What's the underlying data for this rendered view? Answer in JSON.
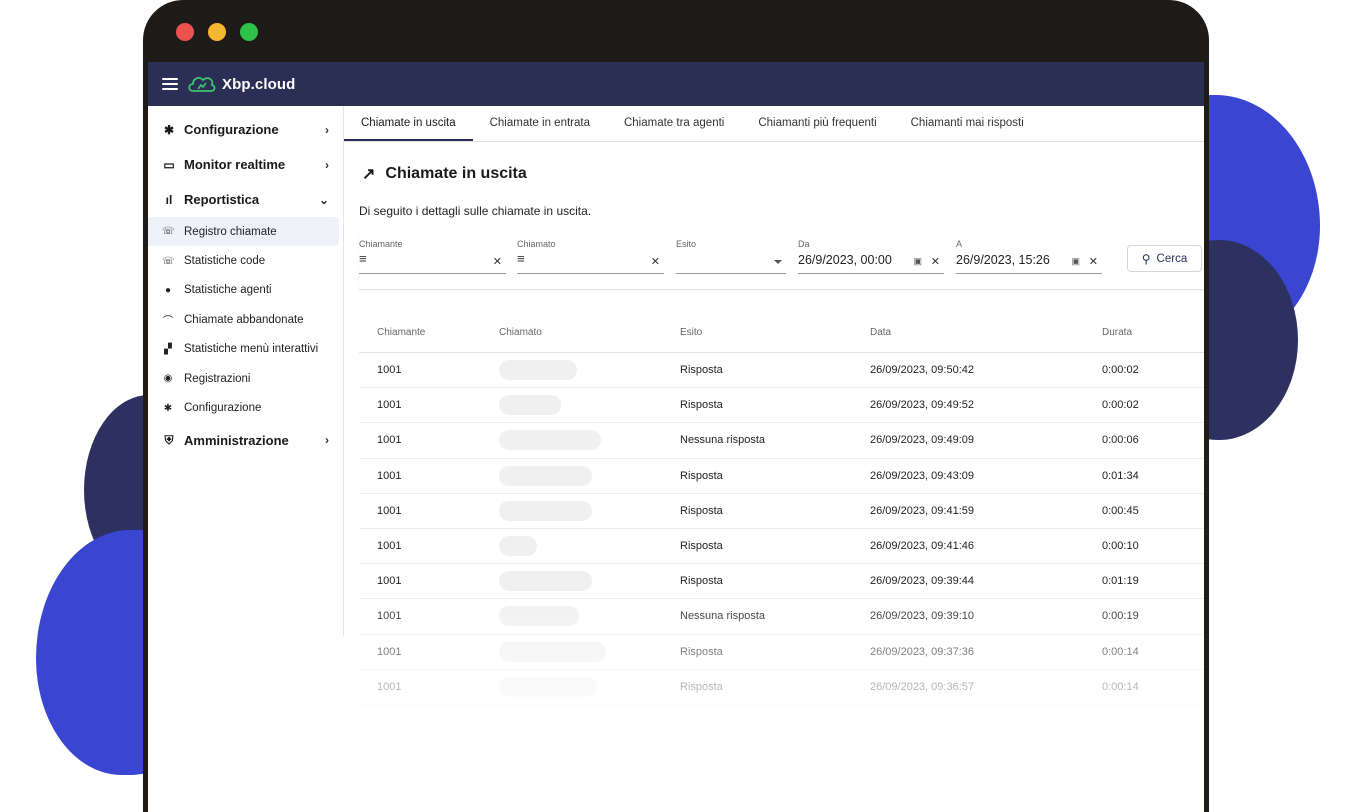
{
  "app": {
    "logo_text": "Xbp.cloud",
    "accent": "#2c2f55",
    "brand_blue": "#3a46d2"
  },
  "sidebar": {
    "groups": [
      {
        "label": "Configurazione",
        "icon": "gear-icon"
      },
      {
        "label": "Monitor realtime",
        "icon": "monitor-icon"
      },
      {
        "label": "Reportistica",
        "icon": "bar-chart-icon"
      },
      {
        "label": "Amministrazione",
        "icon": "shield-icon"
      }
    ],
    "items": [
      {
        "label": "Registro chiamate",
        "icon": "call-log-icon"
      },
      {
        "label": "Statistiche code",
        "icon": "queue-icon"
      },
      {
        "label": "Statistiche agenti",
        "icon": "agent-icon"
      },
      {
        "label": "Chiamate abbandonate",
        "icon": "hangup-icon"
      },
      {
        "label": "Statistiche menù interattivi",
        "icon": "ivr-icon"
      },
      {
        "label": "Registrazioni",
        "icon": "record-icon"
      },
      {
        "label": "Configurazione",
        "icon": "gear-icon"
      }
    ]
  },
  "tabs": [
    {
      "label": "Chiamate in uscita"
    },
    {
      "label": "Chiamate in entrata"
    },
    {
      "label": "Chiamate tra agenti"
    },
    {
      "label": "Chiamanti più frequenti"
    },
    {
      "label": "Chiamanti mai risposti"
    }
  ],
  "page": {
    "title": "Chiamate in uscita",
    "subtitle": "Di seguito i dettagli sulle chiamate in uscita."
  },
  "filters": {
    "caller_label": "Chiamante",
    "called_label": "Chiamato",
    "outcome_label": "Esito",
    "from_label": "Da",
    "from_value": "26/9/2023, 00:00",
    "to_label": "A",
    "to_value": "26/9/2023, 15:26",
    "search_label": "Cerca"
  },
  "table": {
    "headers": [
      "Chiamante",
      "Chiamato",
      "Esito",
      "Data",
      "Durata"
    ],
    "rows": [
      {
        "caller": "1001",
        "outcome": "Risposta",
        "date": "26/09/2023, 09:50:42",
        "duration": "0:00:02"
      },
      {
        "caller": "1001",
        "outcome": "Risposta",
        "date": "26/09/2023, 09:49:52",
        "duration": "0:00:02"
      },
      {
        "caller": "1001",
        "outcome": "Nessuna risposta",
        "date": "26/09/2023, 09:49:09",
        "duration": "0:00:06"
      },
      {
        "caller": "1001",
        "outcome": "Risposta",
        "date": "26/09/2023, 09:43:09",
        "duration": "0:01:34"
      },
      {
        "caller": "1001",
        "outcome": "Risposta",
        "date": "26/09/2023, 09:41:59",
        "duration": "0:00:45"
      },
      {
        "caller": "1001",
        "outcome": "Risposta",
        "date": "26/09/2023, 09:41:46",
        "duration": "0:00:10"
      },
      {
        "caller": "1001",
        "outcome": "Risposta",
        "date": "26/09/2023, 09:39:44",
        "duration": "0:01:19"
      },
      {
        "caller": "1001",
        "outcome": "Nessuna risposta",
        "date": "26/09/2023, 09:39:10",
        "duration": "0:00:19"
      },
      {
        "caller": "1001",
        "outcome": "Risposta",
        "date": "26/09/2023, 09:37:36",
        "duration": "0:00:14"
      },
      {
        "caller": "1001",
        "outcome": "Risposta",
        "date": "26/09/2023, 09:36:57",
        "duration": "0:00:14"
      }
    ]
  }
}
